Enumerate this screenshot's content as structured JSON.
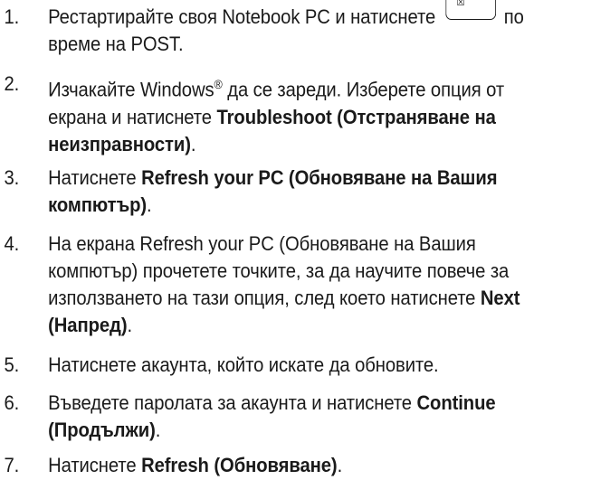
{
  "steps": [
    {
      "number": "1.",
      "line1_before": "Рестартирайте своя Notebook PC и натиснете",
      "key_glyph": "☒",
      "line1_after": "по",
      "line2": "време на POST."
    },
    {
      "number": "2.",
      "line1_a": "Изчакайте Windows",
      "line1_sup": "®",
      "line1_b": " да се зареди. Изберете опция от",
      "line2_plain": "екрана и натиснете ",
      "line2_bold": "Troubleshoot (Отстраняване на",
      "line3_bold": "неизправности)",
      "line3_plain": "."
    },
    {
      "number": "3.",
      "line1_plain": "Натиснете ",
      "line1_bold": "Refresh your PC (Обновяване на Вашия",
      "line2_bold": "компютър)",
      "line2_plain": "."
    },
    {
      "number": "4.",
      "line1": "На екрана Refresh your PC (Обновяване на Вашия",
      "line2": "компютър) прочетете точките, за да научите повече за",
      "line3_plain": "използването на тази опция, след което натиснете ",
      "line3_bold": "Next",
      "line4_bold": "(Напред)",
      "line4_plain": "."
    },
    {
      "number": "5.",
      "line1": "Натиснете акаунта, който искате да обновите."
    },
    {
      "number": "6.",
      "line1_plain": "Въведете паролата за акаунта и натиснете ",
      "line1_bold": "Continue",
      "line2_bold": "(Продължи)",
      "line2_plain": "."
    },
    {
      "number": "7.",
      "line1_plain": "Натиснете ",
      "line1_bold": "Refresh (Обновяване)",
      "line1_end": "."
    }
  ]
}
